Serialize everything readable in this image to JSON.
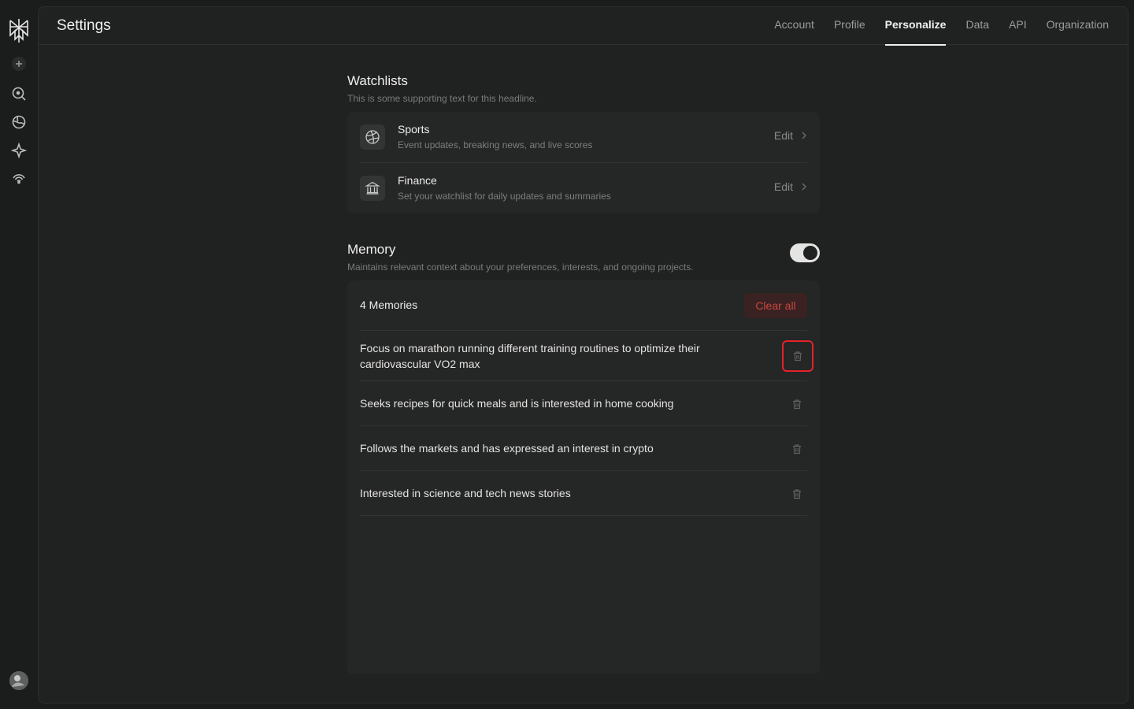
{
  "header": {
    "title": "Settings"
  },
  "tabs": [
    {
      "label": "Account",
      "active": false
    },
    {
      "label": "Profile",
      "active": false
    },
    {
      "label": "Personalize",
      "active": true
    },
    {
      "label": "Data",
      "active": false
    },
    {
      "label": "API",
      "active": false
    },
    {
      "label": "Organization",
      "active": false
    }
  ],
  "sidebar": {
    "icons": [
      "perplexity-logo-icon",
      "plus-icon",
      "search-icon",
      "globe-icon",
      "sparkle-icon",
      "broadcast-icon",
      "avatar"
    ]
  },
  "watchlists": {
    "title": "Watchlists",
    "subtitle": "This is some supporting text for this headline.",
    "items": [
      {
        "name": "Sports",
        "description": "Event updates, breaking news, and live scores",
        "icon": "basketball-icon",
        "action": "Edit"
      },
      {
        "name": "Finance",
        "description": "Set your watchlist for daily updates and summaries",
        "icon": "bank-icon",
        "action": "Edit"
      }
    ]
  },
  "memory": {
    "title": "Memory",
    "subtitle": "Maintains relevant context about your preferences, interests, and ongoing projects.",
    "enabled": true,
    "count_label": "4 Memories",
    "clear_label": "Clear all",
    "items": [
      {
        "text": "Focus on marathon running different training routines to optimize their cardiovascular VO2 max"
      },
      {
        "text": "Seeks recipes for quick meals and is interested in home cooking"
      },
      {
        "text": "Follows the markets and has expressed an interest in crypto"
      },
      {
        "text": "Interested in science and tech news stories"
      }
    ]
  },
  "colors": {
    "background": "#1b1c1c",
    "panel": "#202121",
    "card": "#252626",
    "danger": "#c8453f",
    "focus_ring": "#e5222a"
  }
}
